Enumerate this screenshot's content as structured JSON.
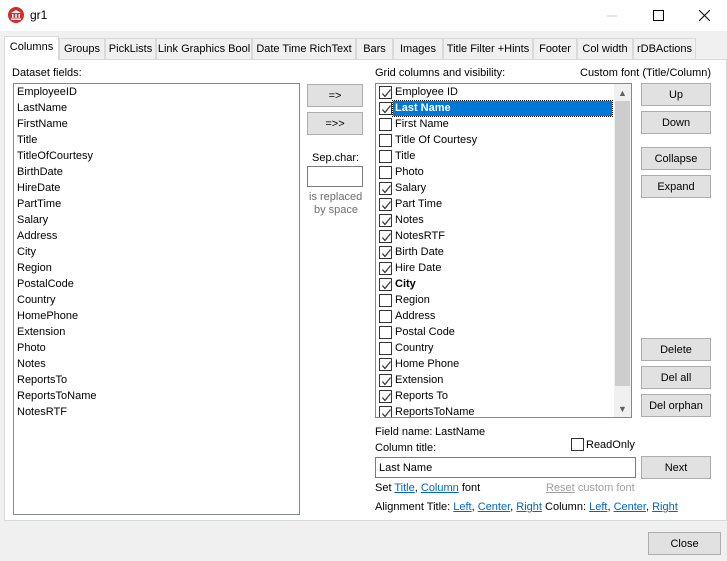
{
  "window": {
    "title": "gr1",
    "icon": "bank-building-icon",
    "controls": [
      "minimize",
      "maximize",
      "close"
    ]
  },
  "tabs": [
    {
      "label": "Columns",
      "active": true
    },
    {
      "label": "Groups"
    },
    {
      "label": "PickLists"
    },
    {
      "label": "Link Graphics Bool"
    },
    {
      "label": "Date Time RichText"
    },
    {
      "label": "Bars"
    },
    {
      "label": "Images"
    },
    {
      "label": "Title Filter +Hints"
    },
    {
      "label": "Footer"
    },
    {
      "label": "Col width"
    },
    {
      "label": "rDBActions"
    }
  ],
  "dataset": {
    "label": "Dataset fields:",
    "fields": [
      "EmployeeID",
      "LastName",
      "FirstName",
      "Title",
      "TitleOfCourtesy",
      "BirthDate",
      "HireDate",
      "PartTime",
      "Salary",
      "Address",
      "City",
      "Region",
      "PostalCode",
      "Country",
      "HomePhone",
      "Extension",
      "Photo",
      "Notes",
      "ReportsTo",
      "ReportsToName",
      "NotesRTF"
    ]
  },
  "middle": {
    "add_button": "=>",
    "add_all_button": "=>>",
    "sep_char_label": "Sep.char:",
    "sep_char_value": "",
    "sep_note_line1": "is replaced",
    "sep_note_line2": "by space"
  },
  "grid": {
    "label": "Grid columns and visibility:",
    "custom_font_label": "Custom font (Title/Column)",
    "columns": [
      {
        "title": "Employee ID",
        "checked": true
      },
      {
        "title": "Last Name",
        "checked": true,
        "selected": true,
        "bold": true
      },
      {
        "title": "First Name",
        "checked": false
      },
      {
        "title": "Title Of Courtesy",
        "checked": false
      },
      {
        "title": "Title",
        "checked": false
      },
      {
        "title": "Photo",
        "checked": false
      },
      {
        "title": "Salary",
        "checked": true
      },
      {
        "title": "Part Time",
        "checked": true
      },
      {
        "title": "Notes",
        "checked": true
      },
      {
        "title": "NotesRTF",
        "checked": true
      },
      {
        "title": "Birth Date",
        "checked": true
      },
      {
        "title": "Hire Date",
        "checked": true
      },
      {
        "title": "City",
        "checked": true,
        "bold": true
      },
      {
        "title": "Region",
        "checked": false
      },
      {
        "title": "Address",
        "checked": false
      },
      {
        "title": "Postal Code",
        "checked": false
      },
      {
        "title": "Country",
        "checked": false
      },
      {
        "title": "Home Phone",
        "checked": true
      },
      {
        "title": "Extension",
        "checked": true
      },
      {
        "title": "Reports To",
        "checked": true
      },
      {
        "title": "ReportsToName",
        "checked": true
      }
    ]
  },
  "side_buttons": {
    "up": "Up",
    "down": "Down",
    "collapse": "Collapse",
    "expand": "Expand",
    "delete": "Delete",
    "del_all": "Del all",
    "del_orphan": "Del orphan"
  },
  "details": {
    "field_name_label": "Field name:",
    "field_name_value": "LastName",
    "column_title_label": "Column title:",
    "column_title_value": "Last Name",
    "readonly_label": "ReadOnly",
    "readonly_checked": false,
    "next_button": "Next",
    "set_label": "Set",
    "title_link": "Title",
    "comma": ",",
    "column_link": "Column",
    "font_label": "font",
    "reset_link": "Reset",
    "reset_suffix": "custom font",
    "alignment_title_label": "Alignment Title:",
    "align_title_left": "Left",
    "align_title_center": "Center",
    "align_title_right": "Right",
    "alignment_column_label": "Column:",
    "align_col_left": "Left",
    "align_col_center": "Center",
    "align_col_right": "Right"
  },
  "footer": {
    "close_button": "Close"
  },
  "colors": {
    "selection": "#0078d7",
    "link": "#0066cc",
    "app_icon": "#d8292b"
  }
}
